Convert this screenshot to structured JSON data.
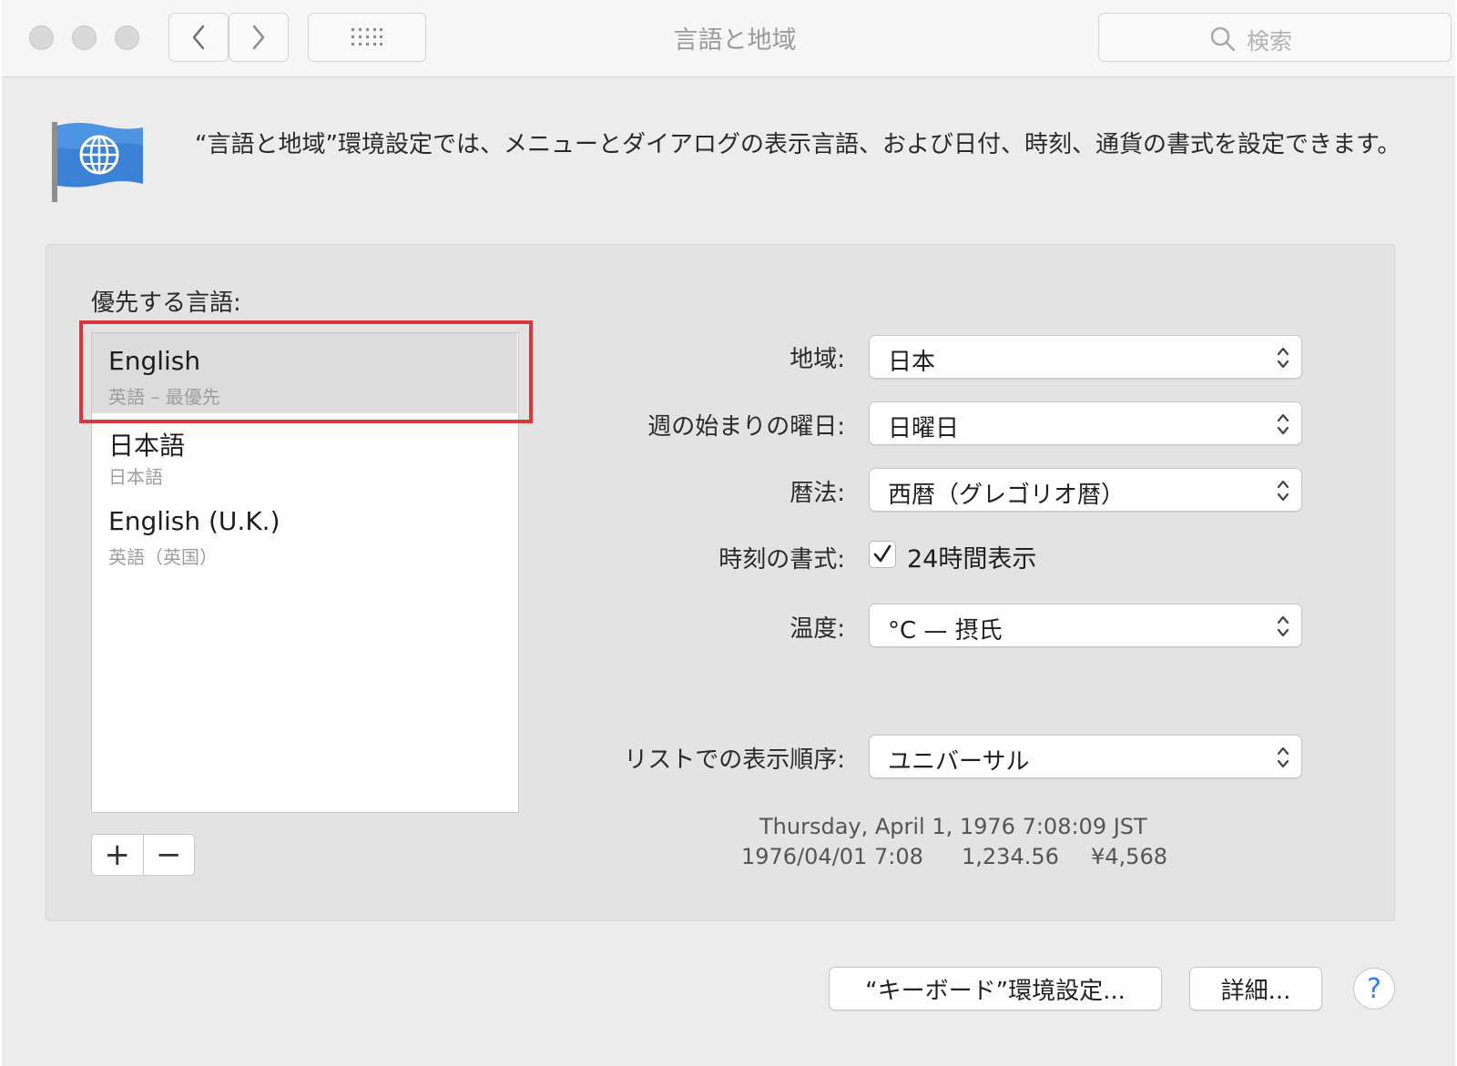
{
  "window": {
    "title": "言語と地域",
    "search_placeholder": "検索",
    "icons": [
      "back-chevron-icon",
      "forward-chevron-icon",
      "grid-icon",
      "search-icon",
      "globe-flag-icon"
    ]
  },
  "header": {
    "description": "“言語と地域”環境設定では、メニューとダイアログの表示言語、および日付、時刻、通貨の書式を設定できます。"
  },
  "preferred_languages": {
    "label": "優先する言語:",
    "items": [
      {
        "name": "English",
        "subtitle": "英語 – 最優先",
        "selected": true
      },
      {
        "name": "日本語",
        "subtitle": "日本語",
        "selected": false
      },
      {
        "name": "English (U.K.)",
        "subtitle": "英語（英国）",
        "selected": false
      }
    ],
    "add_label": "+",
    "remove_label": "−",
    "highlight_color": "#d6393d"
  },
  "settings": {
    "region": {
      "label": "地域:",
      "value": "日本"
    },
    "first_day": {
      "label": "週の始まりの曜日:",
      "value": "日曜日"
    },
    "calendar": {
      "label": "暦法:",
      "value": "西暦（グレゴリオ暦）"
    },
    "time_format": {
      "label": "時刻の書式:",
      "checkbox_label": "24時間表示",
      "checked": true
    },
    "temperature": {
      "label": "温度:",
      "value": "°C — 摂氏"
    },
    "list_sort": {
      "label": "リストでの表示順序:",
      "value": "ユニバーサル"
    }
  },
  "sample": {
    "line1": "Thursday, April 1, 1976 7:08:09 JST",
    "date_short": "1976/04/01 7:08",
    "number": "1,234.56",
    "currency": "¥4,568"
  },
  "buttons": {
    "keyboard_prefs": "“キーボード”環境設定...",
    "advanced": "詳細...",
    "help": "?"
  }
}
